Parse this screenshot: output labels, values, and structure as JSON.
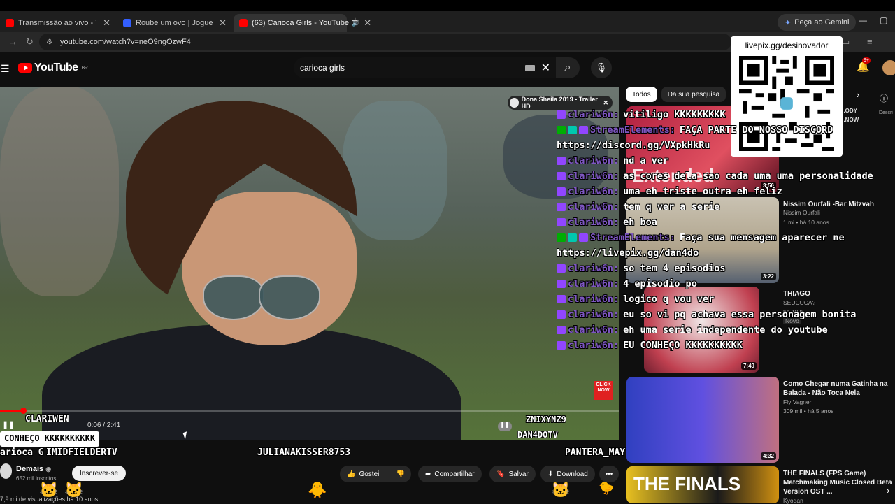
{
  "browser": {
    "tabs": [
      {
        "title": "Transmissão ao vivo - YouTube",
        "color": "#ff0000",
        "active": false
      },
      {
        "title": "Roube um ovo | Jogue na Roblox",
        "color": "#335fff",
        "active": false
      },
      {
        "title": "(63) Carioca Girls - YouTube",
        "color": "#ff0000",
        "active": true
      }
    ],
    "new_tab": "+",
    "gemini_button": "Peça ao Gemini",
    "url": "youtube.com/watch?v=neO9ngOzwF4"
  },
  "youtube": {
    "logo_text": "YouTube",
    "logo_region": "BR",
    "search_value": "carioca girls",
    "notifications_badge": "9+"
  },
  "player": {
    "time": "0:06 / 2:41",
    "progress_fraction": 0.037,
    "trailer_card": "Dona Sheila 2019 - Trailer HD",
    "click_now": "CLICK NOW"
  },
  "stream_overlay": {
    "left_name": "CLARIWEN",
    "bottom_left_partial": "arioca G",
    "sub_name_1": "IMIDFIELDERTV",
    "sub_name_2": "JULIANAKISSER8753",
    "sub_name_3": "PANTERA_MAY",
    "right_name_1": "ZNIXYNZ9",
    "right_name_2": "DAN4DOTV",
    "highlight_msg": "CONHEÇO KKKKKKKKKK"
  },
  "chat": [
    {
      "user": "clariw6n",
      "msg": "vitiligo KKKKKKKKK",
      "badges": [
        "twitch"
      ]
    },
    {
      "user": "StreamElements",
      "msg": "FAÇA PARTE DO NOSSO DISCORD",
      "badges": [
        "mod",
        "bot",
        "twitch"
      ]
    },
    {
      "user": "",
      "msg": "https://discord.gg/VXpkHkRu",
      "badges": []
    },
    {
      "user": "clariw6n",
      "msg": "nd a ver",
      "badges": [
        "twitch"
      ]
    },
    {
      "user": "clariw6n",
      "msg": "as cores dela sao cada uma uma personalidade",
      "badges": [
        "twitch"
      ]
    },
    {
      "user": "clariw6n",
      "msg": "uma eh triste outra eh feliz",
      "badges": [
        "twitch"
      ]
    },
    {
      "user": "clariw6n",
      "msg": "tem q ver a serie",
      "badges": [
        "twitch"
      ]
    },
    {
      "user": "clariw6n",
      "msg": "eh boa",
      "badges": [
        "twitch"
      ]
    },
    {
      "user": "StreamElements",
      "msg": "Faça sua mensagem aparecer ne",
      "badges": [
        "mod",
        "bot",
        "twitch"
      ]
    },
    {
      "user": "",
      "msg": "https://livepix.gg/dan4do",
      "badges": []
    },
    {
      "user": "clariw6n",
      "msg": "so tem 4 episodios",
      "badges": [
        "twitch"
      ]
    },
    {
      "user": "clariw6n",
      "msg": "4 episodio po",
      "badges": [
        "twitch"
      ]
    },
    {
      "user": "clariw6n",
      "msg": "logico q vou ver",
      "badges": [
        "twitch"
      ]
    },
    {
      "user": "clariw6n",
      "msg": "eu so vi pq achava essa personagem bonita",
      "badges": [
        "twitch"
      ]
    },
    {
      "user": "clariw6n",
      "msg": "eh uma serie independente do youtube",
      "badges": [
        "twitch"
      ]
    },
    {
      "user": "clariw6n",
      "msg": "EU CONHEÇO KKKKKKKKKK",
      "badges": [
        "twitch"
      ]
    }
  ],
  "qr": {
    "text": "livepix.gg/desinovador"
  },
  "recommendations": {
    "chips": [
      "Todos",
      "Da sua pesquisa"
    ],
    "description_label": "Descri",
    "items": [
      {
        "title": "",
        "channel": "",
        "meta": "",
        "duration": "3:56",
        "thumb_text": "Extended",
        "partial_title": "...ODY ...NOW"
      },
      {
        "title": "Nissim Ourfali -Bar Mitzvah",
        "channel": "Nissim Ourfali",
        "meta": "1 mi • há 10 anos",
        "duration": "3:22"
      },
      {
        "title": "THIAGO",
        "channel": "SEUCUCA?",
        "meta": "há 10 h",
        "badge": "Novo",
        "duration": "7:49"
      },
      {
        "title": "Como Chegar numa Gatinha na Balada - Não Toca Nela",
        "channel": "Fly Vagner",
        "meta": "309 mil • há 5 anos",
        "duration": "4:32"
      },
      {
        "title": "THE FINALS (FPS Game) Matchmaking Music Closed Beta Version OST ...",
        "channel": "Kyodan",
        "meta": "",
        "duration": "",
        "thumb_text": "THE FINALS"
      }
    ]
  },
  "below_video": {
    "channel_name": "Demais",
    "subscribers": "652 mil inscritos",
    "subscribe": "Inscrever-se",
    "like": "Gostei",
    "share": "Compartilhar",
    "save": "Salvar",
    "download": "Download",
    "more": "•••",
    "views": "7,9 mi de visualizações há 10 anos"
  }
}
